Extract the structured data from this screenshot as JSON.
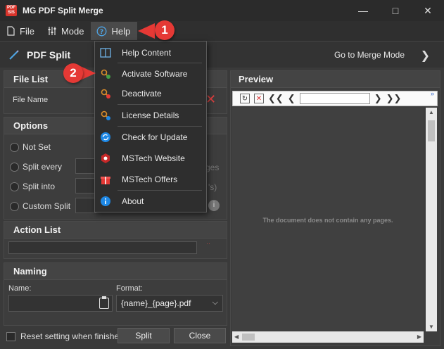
{
  "window": {
    "title": "MG PDF Split Merge",
    "app_icon_text": "PDF\nSIS"
  },
  "menubar": {
    "file": "File",
    "mode": "Mode",
    "help": "Help"
  },
  "header": {
    "title": "PDF Split",
    "merge_link": "Go to Merge Mode"
  },
  "file_list": {
    "heading": "File List",
    "column": "File Name"
  },
  "options": {
    "heading": "Options",
    "not_set": "Not Set",
    "split_every": "Split every",
    "split_into": "Split into",
    "custom_split": "Custom Split",
    "pages_suffix_partial": "ges",
    "files_suffix_partial": "'s)"
  },
  "action_list": {
    "heading": "Action List"
  },
  "naming": {
    "heading": "Naming",
    "name_label": "Name:",
    "format_label": "Format:",
    "format_value": "{name}_{page}.pdf"
  },
  "preview": {
    "heading": "Preview",
    "empty_message": "The document does not contain any pages."
  },
  "bottom": {
    "reset_label": "Reset setting when finished",
    "split_button": "Split",
    "close_button": "Close"
  },
  "help_menu": [
    {
      "label": "Help Content",
      "icon": "book-icon"
    },
    {
      "label": "Activate Software",
      "icon": "key-check-icon"
    },
    {
      "label": "Deactivate",
      "icon": "key-cross-icon"
    },
    {
      "label": "License Details",
      "icon": "key-info-icon"
    },
    {
      "label": "Check for Update",
      "icon": "refresh-icon"
    },
    {
      "label": "MSTech Website",
      "icon": "globe-icon"
    },
    {
      "label": "MSTech Offers",
      "icon": "gift-icon"
    },
    {
      "label": "About",
      "icon": "info-icon"
    }
  ],
  "callouts": {
    "one": "1",
    "two": "2"
  },
  "colors": {
    "accent": "#e53935",
    "background": "#3a3a3a",
    "menu_bg": "#2e2e2e"
  }
}
